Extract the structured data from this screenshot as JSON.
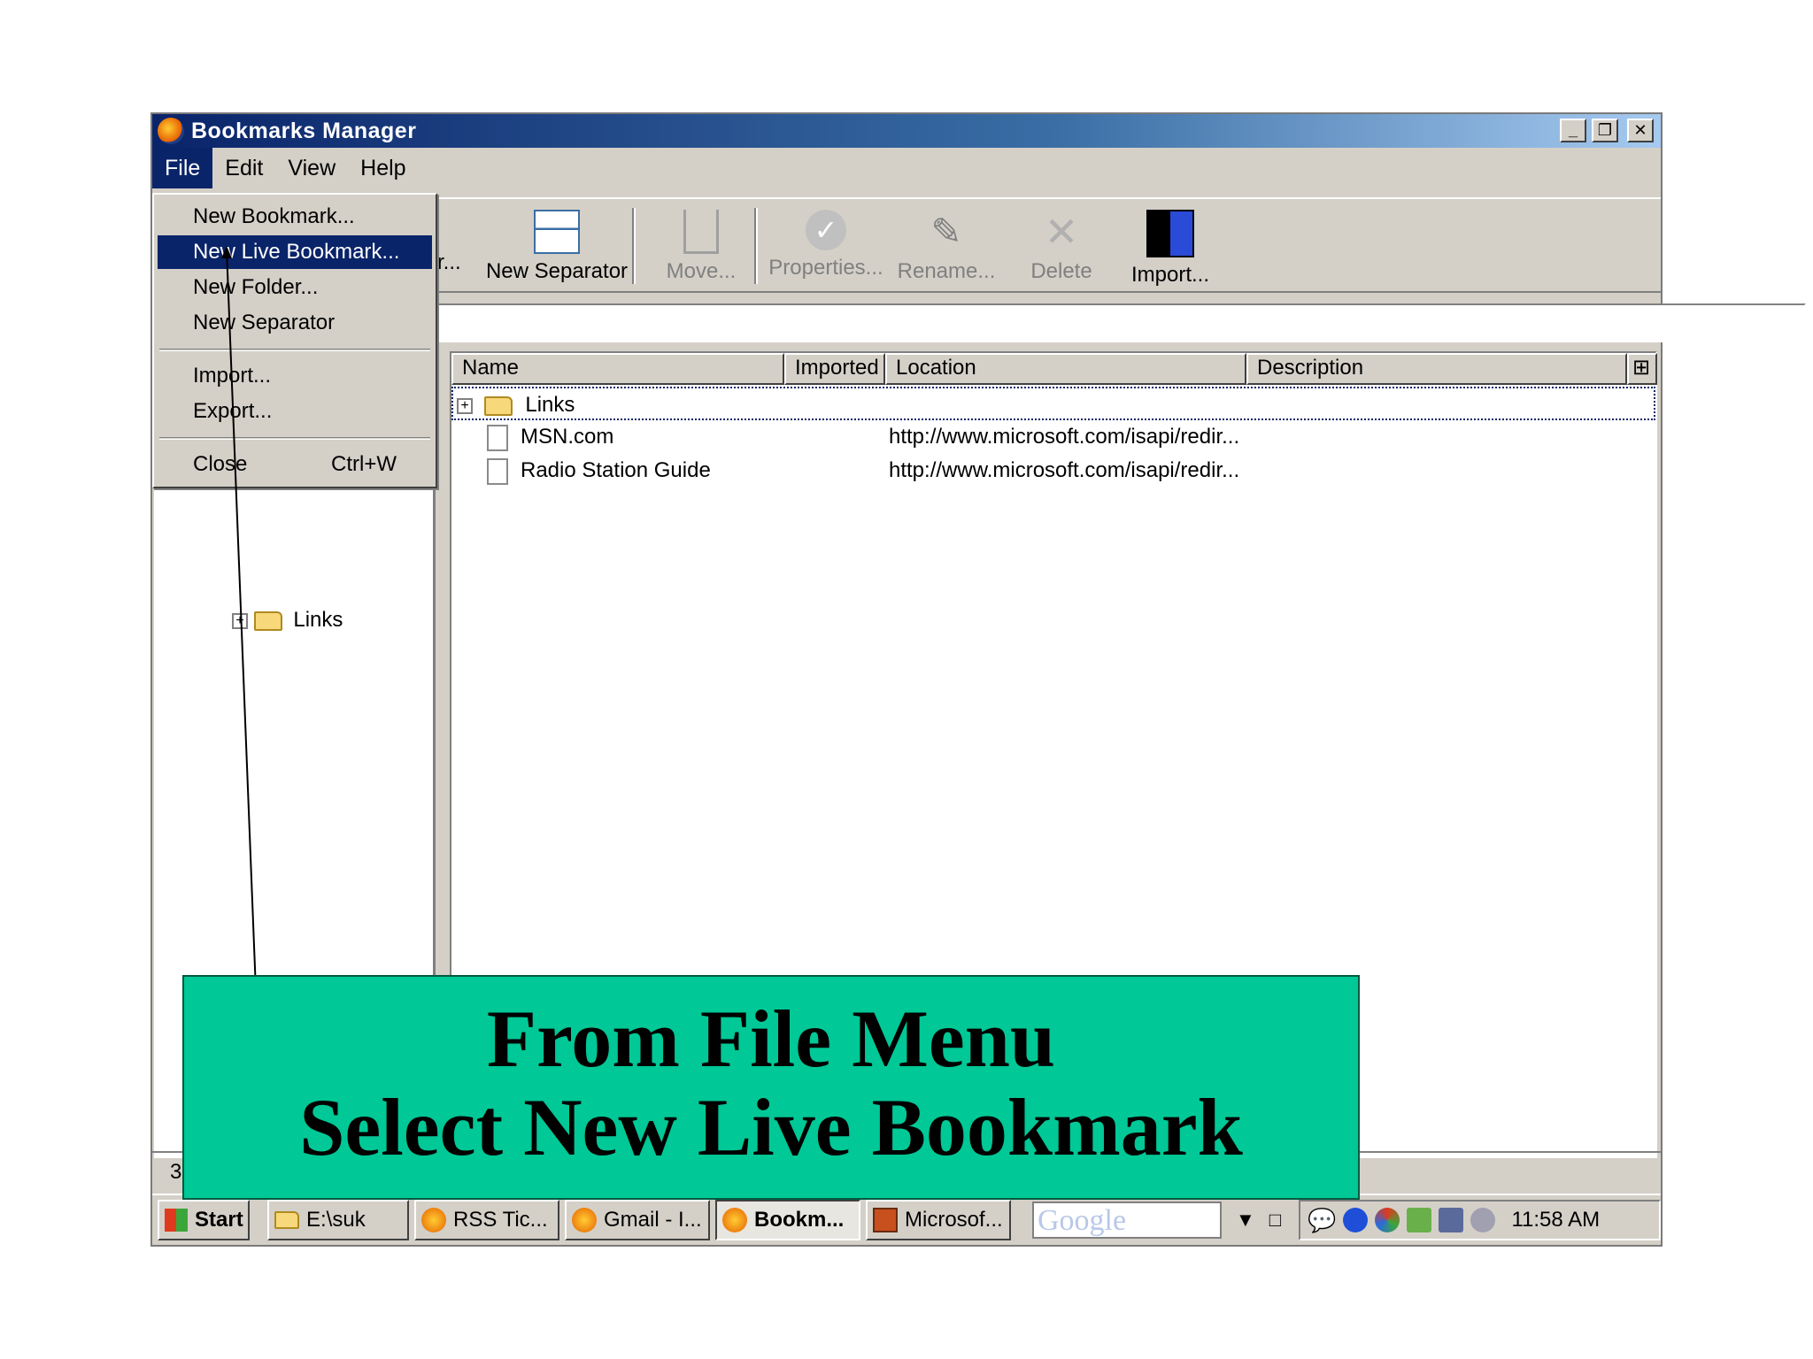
{
  "window": {
    "title": "Bookmarks Manager",
    "caption_buttons": [
      "minimize-icon",
      "restore-icon",
      "close-icon"
    ]
  },
  "menubar": {
    "items": [
      "File",
      "Edit",
      "View",
      "Help"
    ],
    "active": "File"
  },
  "toolbar": {
    "partial_label": "r...",
    "new_separator": "New Separator",
    "move": "Move...",
    "properties": "Properties...",
    "rename": "Rename...",
    "delete": "Delete",
    "import": "Import..."
  },
  "file_menu": {
    "new_bookmark": "New Bookmark...",
    "new_live_bookmark": "New Live Bookmark...",
    "new_folder": "New Folder...",
    "new_separator": "New Separator",
    "import": "Import...",
    "export": "Export...",
    "close": "Close",
    "close_shortcut": "Ctrl+W"
  },
  "tree": {
    "links_label": "Links"
  },
  "columns": {
    "name": "Name",
    "imported": "Imported",
    "location": "Location",
    "description": "Description"
  },
  "rows": [
    {
      "name": "Links",
      "location": ""
    },
    {
      "name": "MSN.com",
      "location": "http://www.microsoft.com/isapi/redir..."
    },
    {
      "name": "Radio Station Guide",
      "location": "http://www.microsoft.com/isapi/redir..."
    }
  ],
  "statusbar": {
    "text": "3"
  },
  "taskbar": {
    "start": "Start",
    "buttons": [
      "E:\\suk",
      "RSS Tic...",
      "Gmail - I...",
      "Bookm...",
      "Microsof..."
    ],
    "search_placeholder": "Google",
    "clock": "11:58 AM"
  },
  "callout": {
    "line1": "From File Menu",
    "line2": "Select New Live Bookmark"
  },
  "colors": {
    "titlebar": "#0a246a",
    "highlight": "#0a246a",
    "callout": "#00c896",
    "chrome": "#d4d0c8"
  }
}
